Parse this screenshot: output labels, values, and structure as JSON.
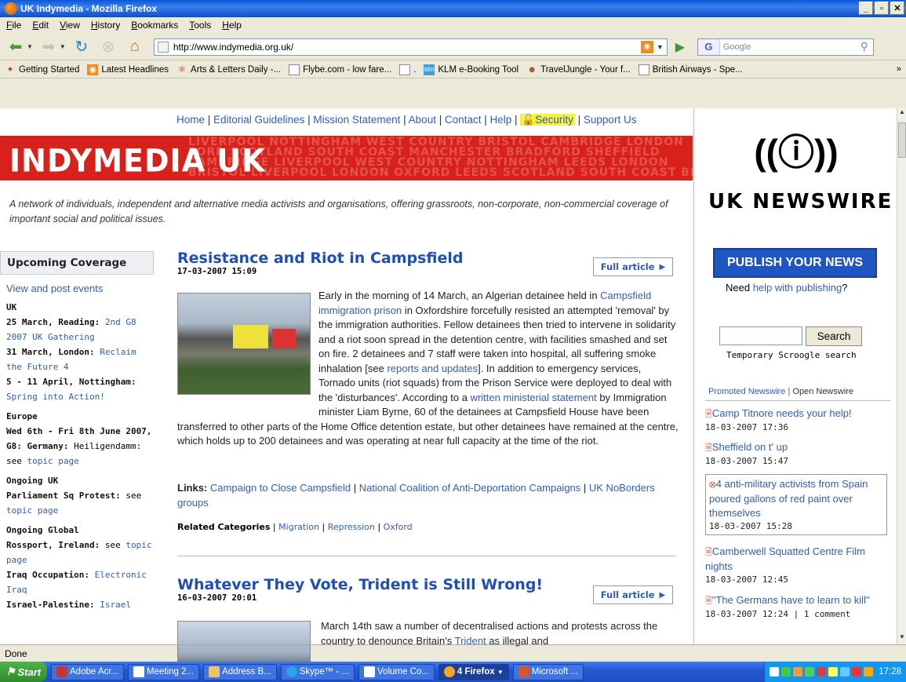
{
  "window": {
    "title": "UK Indymedia - Mozilla Firefox",
    "min": "_",
    "max": "▫",
    "close": "✕"
  },
  "menu": [
    "File",
    "Edit",
    "View",
    "History",
    "Bookmarks",
    "Tools",
    "Help"
  ],
  "nav": {
    "url": "http://www.indymedia.org.uk/",
    "search_placeholder": "Google",
    "search_engine": "G"
  },
  "bookmarks": [
    "Getting Started",
    "Latest Headlines",
    "Arts & Letters Daily -...",
    "Flybe.com - low fare...",
    ".",
    "KLM e-Booking Tool",
    "TravelJungle - Your f...",
    "British Airways - Spe..."
  ],
  "bookmarks_more": "»",
  "top_links": [
    "Home",
    "Editorial Guidelines",
    "Mission Statement",
    "About",
    "Contact",
    "Help",
    "Security",
    "Support Us"
  ],
  "top_links_sep": " | ",
  "banner": {
    "logo": "INDYMEDIA UK",
    "bg_lines": [
      "LIVERPOOL NOTTINGHAM WEST COUNTRY BRISTOL CAMBRIDGE LONDON",
      "FORD SCOTLAND SOUTH COAST MANCHESTER BRADFORD SHEFFIELD",
      "CAMBRIDGE LIVERPOOL WEST COUNTRY NOTTINGHAM LEEDS LONDON",
      "BRISTOL LIVERPOOL LONDON OXFORD LEEDS SCOTLAND SOUTH COAST BI"
    ]
  },
  "tagline": "A network of individuals, independent and alternative media activists and organisations, offering grassroots, non-corporate, non-commercial coverage of important social and political issues.",
  "upcoming": {
    "title": "Upcoming Coverage",
    "view_post": "View and post events",
    "items": [
      {
        "head": "UK"
      },
      {
        "bold": "25 March, Reading:",
        "link": "2nd G8 2007 UK Gathering"
      },
      {
        "bold": "31 March, London:",
        "link": "Reclaim the Future 4"
      },
      {
        "bold": "5 - 11 April, Nottingham:",
        "link": "Spring into Action!"
      },
      {
        "head": "Europe"
      },
      {
        "bold": "Wed 6th - Fri 8th June 2007, G8: Germany:",
        "text": "Heiligendamm: see",
        "link": "topic page"
      },
      {
        "head": "Ongoing UK"
      },
      {
        "bold": "Parliament Sq Protest:",
        "text": "see",
        "link": "topic page"
      },
      {
        "head": "Ongoing Global"
      },
      {
        "bold": "Rossport, Ireland:",
        "text": "see",
        "link": "topic page"
      },
      {
        "bold": "Iraq Occupation:",
        "link": "Electronic Iraq"
      },
      {
        "bold": "Israel-Palestine:",
        "link": "Israel"
      }
    ]
  },
  "articles": [
    {
      "title": "Resistance and Riot in Campsfield",
      "date": "17-03-2007 15:09",
      "full": "Full article",
      "body_before": "Early in the morning of 14 March, an Algerian detainee held in ",
      "body_link1": "Campsfield immigration prison",
      "body_mid1": " in Oxfordshire forcefully resisted an attempted 'removal' by the immigration authorities. Fellow detainees then tried to intervene in solidarity and a riot soon spread in the detention centre, with facilities smashed and set on fire. 2 detainees and 7 staff were taken into hospital, all suffering smoke inhalation [see ",
      "body_link2": "reports and updates",
      "body_mid2": "]. In addition to emergency services, Tornado units (riot squads) from the Prison Service were deployed to deal with the 'disturbances'. According to a ",
      "body_link3": "written ministerial statement",
      "body_after": " by Immigration minister Liam Byrne, 60 of the detainees at Campsfield House have been transferred to other parts of the Home Office detention estate, but other detainees have remained at the centre, which holds up to 200 detainees and was operating at near full capacity at the time of the riot.",
      "links_label": "Links:",
      "links": [
        "Campaign to Close Campsfield",
        "National Coalition of Anti-Deportation Campaigns",
        "UK NoBorders groups"
      ],
      "related_label": "Related Categories",
      "related": [
        "Migration",
        "Repression",
        "Oxford"
      ]
    },
    {
      "title": "Whatever They Vote, Trident is Still Wrong!",
      "date": "16-03-2007 20:01",
      "full": "Full article",
      "body_before": "March 14th saw a number of decentralised actions and protests across the country to denounce Britain's ",
      "body_link1": "Trident",
      "body_after": " as illegal and"
    }
  ],
  "newswire": {
    "title": "UK NEWSWIRE",
    "publish": "PUBLISH YOUR NEWS",
    "need": "Need ",
    "help_link": "help with publishing",
    "need_end": "?",
    "search_btn": "Search",
    "temp_search": "Temporary Scroogle search",
    "tab_promoted": "Promoted Newswire",
    "tab_open": "Open Newswire",
    "items": [
      {
        "title": "Camp Titnore needs your help!",
        "date": "18-03-2007 17:36"
      },
      {
        "title": "Sheffield on t' up",
        "date": "18-03-2007 15:47"
      },
      {
        "title": "4 anti-military activists from Spain poured gallons of red paint over themselves",
        "date": "18-03-2007 15:28"
      },
      {
        "title": "Camberwell Squatted Centre Film nights",
        "date": "18-03-2007 12:45"
      },
      {
        "title": "\"The Germans have to learn to kill\"",
        "date": "18-03-2007 12:24 | 1 comment"
      }
    ]
  },
  "status": "Done",
  "taskbar": {
    "start": "Start",
    "buttons": [
      "Adobe Acr...",
      "Meeting 2...",
      "Address B...",
      "Skype™ - ...",
      "Volume Co...",
      "4 Firefox",
      "Microsoft ..."
    ],
    "clock": "17:28"
  },
  "colors": {
    "banner_red": "#d8211b",
    "link_blue": "#2f5dbd",
    "publish_blue": "#1f55c2",
    "highlight_yellow": "#f7f33a"
  }
}
